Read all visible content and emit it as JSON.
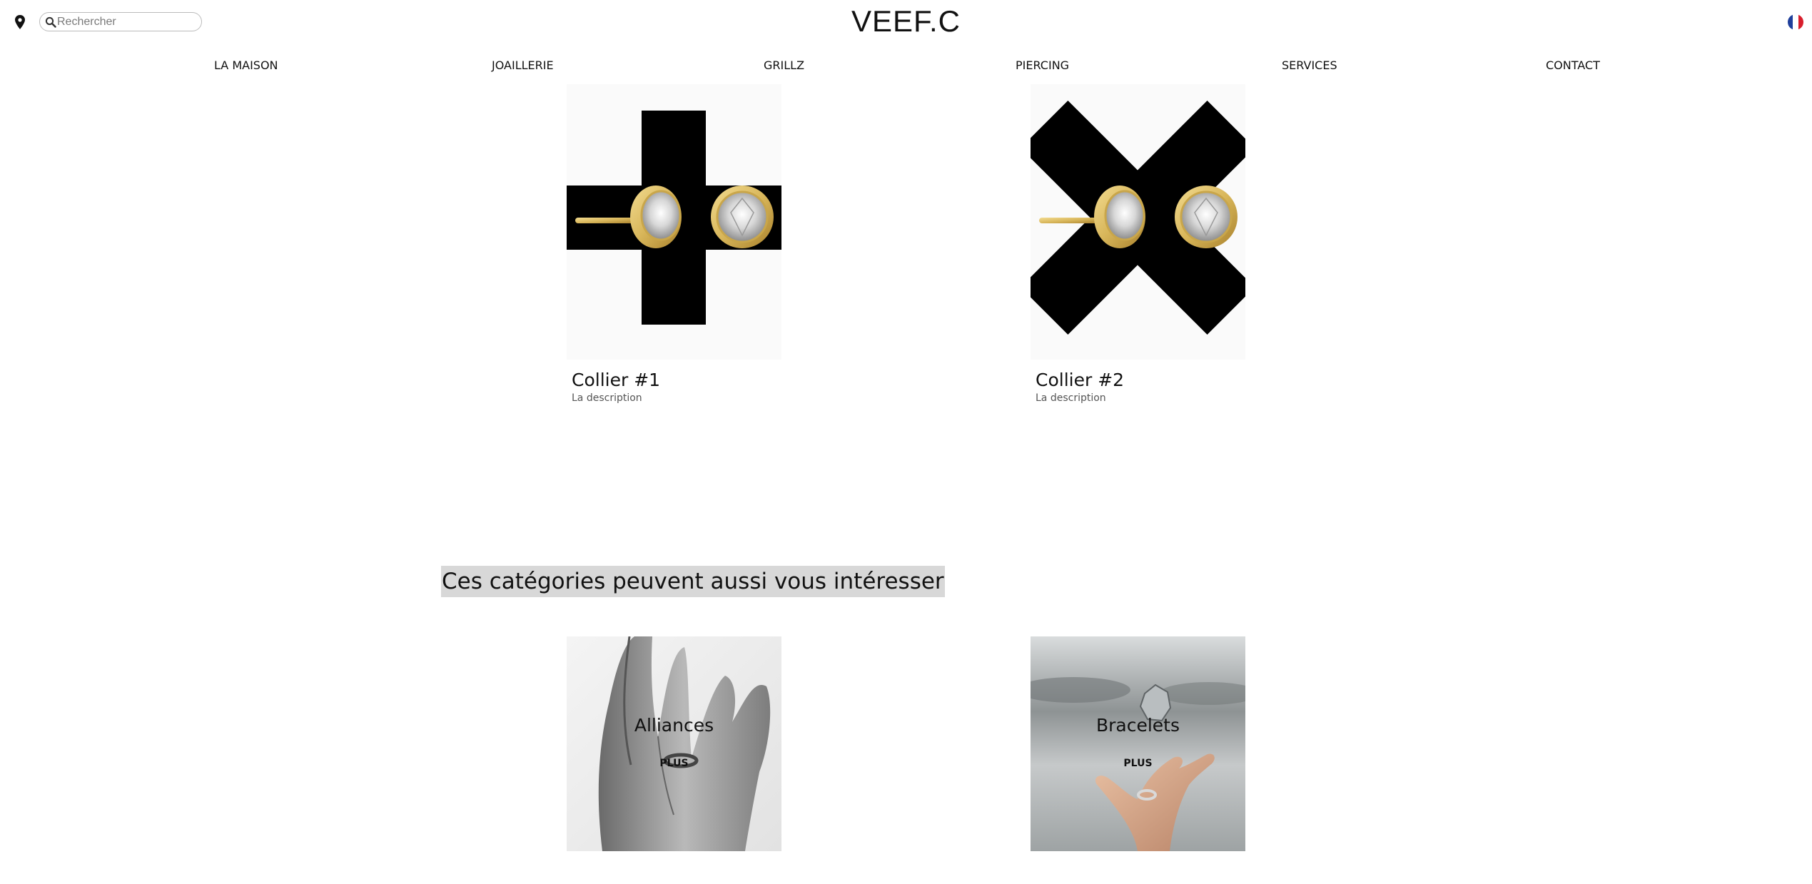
{
  "header": {
    "brand": "VEEF.C",
    "search_placeholder": "Rechercher",
    "location_icon": "location-pin-icon",
    "search_icon": "search-icon",
    "language_flag": "french-flag-icon"
  },
  "nav": {
    "items": [
      {
        "label": "LA MAISON"
      },
      {
        "label": "JOAILLERIE"
      },
      {
        "label": "GRILLZ"
      },
      {
        "label": "PIERCING"
      },
      {
        "label": "SERVICES"
      },
      {
        "label": "CONTACT"
      }
    ]
  },
  "products": [
    {
      "name": "Collier #1",
      "description": "La description",
      "image": "gold-stud-earrings-on-black-cross"
    },
    {
      "name": "Collier #2",
      "description": "La description",
      "image": "gold-stud-earrings-on-black-x"
    }
  ],
  "related": {
    "title": "Ces catégories peuvent aussi vous intéresser",
    "categories": [
      {
        "label": "Alliances",
        "more": "PLUS",
        "image": "hand-with-ring-grayscale"
      },
      {
        "label": "Bracelets",
        "more": "PLUS",
        "image": "open-hand-with-floating-stone"
      }
    ]
  },
  "colors": {
    "text": "#111111",
    "section_title_bg": "#d8d8d8",
    "flag_blue": "#1f3f9b",
    "flag_red": "#d81e2c",
    "gold": "#d8b65a"
  }
}
